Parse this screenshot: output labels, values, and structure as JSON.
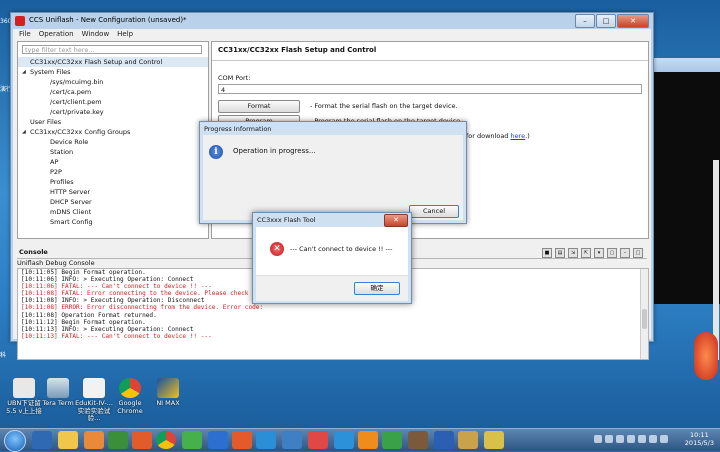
{
  "window": {
    "title": "CCS Uniflash - New Configuration (unsaved)*",
    "minimize": "–",
    "maximize": "□",
    "close": "✕"
  },
  "menu": [
    "File",
    "Operation",
    "Window",
    "Help"
  ],
  "tree": {
    "filter_placeholder": "type filter text here...",
    "items": [
      {
        "label": "CC31xx/CC32xx Flash Setup and Control",
        "level": 1,
        "twisty": "",
        "selected": true
      },
      {
        "label": "System Files",
        "level": 1,
        "twisty": "◢"
      },
      {
        "label": "/sys/mcuimg.bin",
        "level": 2,
        "twisty": ""
      },
      {
        "label": "/cert/ca.pem",
        "level": 2,
        "twisty": ""
      },
      {
        "label": "/cert/client.pem",
        "level": 2,
        "twisty": ""
      },
      {
        "label": "/cert/private.key",
        "level": 2,
        "twisty": ""
      },
      {
        "label": "User Files",
        "level": 1,
        "twisty": ""
      },
      {
        "label": "CC31xx/CC32xx Config Groups",
        "level": 1,
        "twisty": "◢"
      },
      {
        "label": "Device Role",
        "level": 2,
        "twisty": ""
      },
      {
        "label": "Station",
        "level": 2,
        "twisty": ""
      },
      {
        "label": "AP",
        "level": 2,
        "twisty": ""
      },
      {
        "label": "P2P",
        "level": 2,
        "twisty": ""
      },
      {
        "label": "Profiles",
        "level": 2,
        "twisty": ""
      },
      {
        "label": "HTTP Server",
        "level": 2,
        "twisty": ""
      },
      {
        "label": "DHCP Server",
        "level": 2,
        "twisty": ""
      },
      {
        "label": "mDNS Client",
        "level": 2,
        "twisty": ""
      },
      {
        "label": "Smart Config",
        "level": 2,
        "twisty": ""
      }
    ]
  },
  "setup": {
    "heading": "CC31xx/CC32xx Flash Setup and Control",
    "com_port_label": "COM Port:",
    "com_port_value": "4",
    "format_button": "Format",
    "format_desc": "- Format the serial flash on the target device.",
    "program_button": "Program",
    "program_desc": "- Program the serial flash on the target device.",
    "download_desc_prefix": "for download",
    "download_link": "here",
    "download_desc_suffix": ".)"
  },
  "console": {
    "tab_label": "Console",
    "title": "Uniflash Debug Console",
    "icons": [
      "■",
      "▤",
      "⇲",
      "⇱",
      "▾",
      "▢",
      "–",
      "□"
    ],
    "lines": [
      {
        "text": "[10:11:05] Begin Format operation.",
        "type": "info"
      },
      {
        "text": "[10:11:06] INFO: > Executing Operation: Connect",
        "type": "info"
      },
      {
        "text": "[10:11:06] FATAL: --- Can't connect to device !! ---",
        "type": "err"
      },
      {
        "text": "[10:11:08] FATAL: Error connecting to the device. Please check your",
        "type": "err"
      },
      {
        "text": "[10:11:08] INFO: > Executing Operation: Disconnect",
        "type": "info"
      },
      {
        "text": "[10:11:08] ERROR: Error disconnecting from the device. Error code:",
        "type": "err"
      },
      {
        "text": "[10:11:08] Operation Format returned.",
        "type": "info"
      },
      {
        "text": "[10:11:12] Begin Format operation.",
        "type": "info"
      },
      {
        "text": "[10:11:13] INFO: > Executing Operation: Connect",
        "type": "info"
      },
      {
        "text": "[10:11:13] FATAL: --- Can't connect to device !! ---",
        "type": "err"
      }
    ]
  },
  "progress_dialog": {
    "title": "Progress Information",
    "message": "Operation in progress...",
    "cancel_button": "Cancel"
  },
  "error_dialog": {
    "title": "CC3xxx Flash Tool",
    "close": "✕",
    "message": "--- Can't connect to device !! ---",
    "ok_button": "确定"
  },
  "desktop_icons": [
    {
      "label": "UBN下证留\n5.5 v上上接"
    },
    {
      "label": "Tera Term"
    },
    {
      "label": "EduKit-IV-...\n实验实验试验..."
    },
    {
      "label": "Google\nChrome"
    },
    {
      "label": "NI MAX"
    }
  ],
  "clock": {
    "time": "10:11",
    "date": "2015/5/3"
  },
  "colors": {
    "accent": "#1e4fb0",
    "error": "#d21f1f",
    "link": "#1a3fd1"
  }
}
